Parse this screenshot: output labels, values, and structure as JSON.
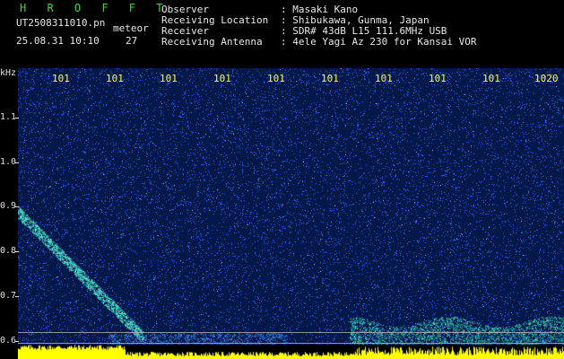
{
  "header": {
    "app_title": "H R O F F T",
    "filename": "UT2508311010.pn",
    "meteor_label": "meteor",
    "datetime": "25.08.31 10:10",
    "count": "27",
    "fields": [
      {
        "label": "Observer",
        "value": ": Masaki Kano"
      },
      {
        "label": "Receiving Location",
        "value": ": Shibukawa, Gunma, Japan"
      },
      {
        "label": "Receiver",
        "value": ": SDR# 43dB L15 111.6MHz USB"
      },
      {
        "label": "Receiving Antenna",
        "value": ": 4ele Yagi Az 230 for Kansai VOR"
      }
    ]
  },
  "spectrogram": {
    "y_unit": "kHz",
    "y_ticks": [
      "1.1",
      "1.0",
      "0.9",
      "0.8",
      "0.7",
      "0.6"
    ],
    "x_ticks": [
      "101",
      "101",
      "101",
      "101",
      "101",
      "101",
      "101",
      "101",
      "101",
      "1020"
    ],
    "colors": {
      "background": "#05184a",
      "noise": "#2a5cff",
      "signal": "#22ffcc",
      "strip": "#ffff00"
    }
  }
}
